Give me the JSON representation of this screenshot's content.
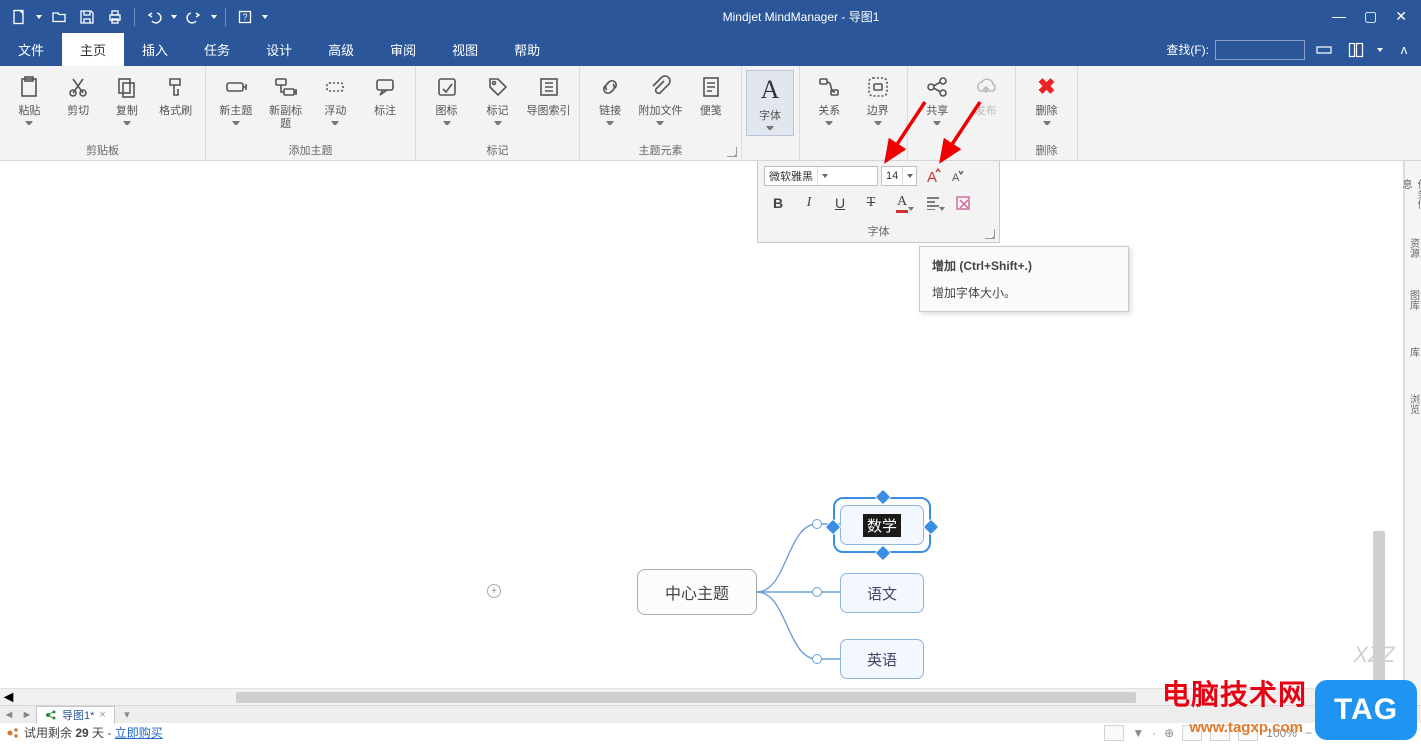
{
  "app": {
    "title": "Mindjet MindManager - 导图1"
  },
  "qat": {
    "new": "新建",
    "open": "打开",
    "save": "保存",
    "print": "打印",
    "undo": "撤销",
    "redo": "重做",
    "help": "帮助"
  },
  "menu": {
    "file": "文件",
    "home": "主页",
    "insert": "插入",
    "task": "任务",
    "design": "设计",
    "advanced": "高级",
    "review": "审阅",
    "view": "视图",
    "help": "帮助",
    "find_label": "查找(F):"
  },
  "ribbon": {
    "groups": {
      "clipboard": {
        "label": "剪贴板",
        "paste": "粘贴",
        "cut": "剪切",
        "copy": "复制",
        "format_painter": "格式刷"
      },
      "addtopic": {
        "label": "添加主题",
        "new_topic": "新主题",
        "new_subtopic": "新副标题",
        "floating": "浮动",
        "callout": "标注"
      },
      "markers": {
        "label": "标记",
        "icons": "图标",
        "tags": "标记",
        "map_index": "导图索引"
      },
      "elements": {
        "label": "主题元素",
        "link": "链接",
        "attachment": "附加文件",
        "notes": "便笺"
      },
      "font": {
        "label": "字体",
        "btn": "字体"
      },
      "relation": {
        "label": "",
        "relationship": "关系",
        "boundary": "边界"
      },
      "share": {
        "label": "",
        "share": "共享",
        "publish": "发布"
      },
      "delete": {
        "label": "删除",
        "btn": "删除"
      }
    }
  },
  "font_panel": {
    "family": "微软雅黑",
    "size": "14",
    "grow": "A",
    "shrink": "A",
    "bold": "B",
    "italic": "I",
    "underline": "U",
    "strike": "T",
    "group_label": "字体"
  },
  "tooltip": {
    "title": "增加 (Ctrl+Shift+.)",
    "body": "增加字体大小。"
  },
  "map": {
    "central": "中心主题",
    "children": [
      "数学",
      "语文",
      "英语"
    ]
  },
  "rightbar": [
    "任务信息",
    "资源",
    "图库",
    "库",
    "浏览"
  ],
  "doctab": {
    "name": "导图1*"
  },
  "status": {
    "trial_prefix": "试用剩余 ",
    "trial_days": "29",
    "trial_suffix": " 天 - ",
    "buy_now": "立即购买",
    "zoom": "100%"
  },
  "watermark": {
    "site_cn": "电脑技术网",
    "site_url": "www.tagxp.com",
    "tag": "TAG",
    "xzz": "XZZ"
  }
}
